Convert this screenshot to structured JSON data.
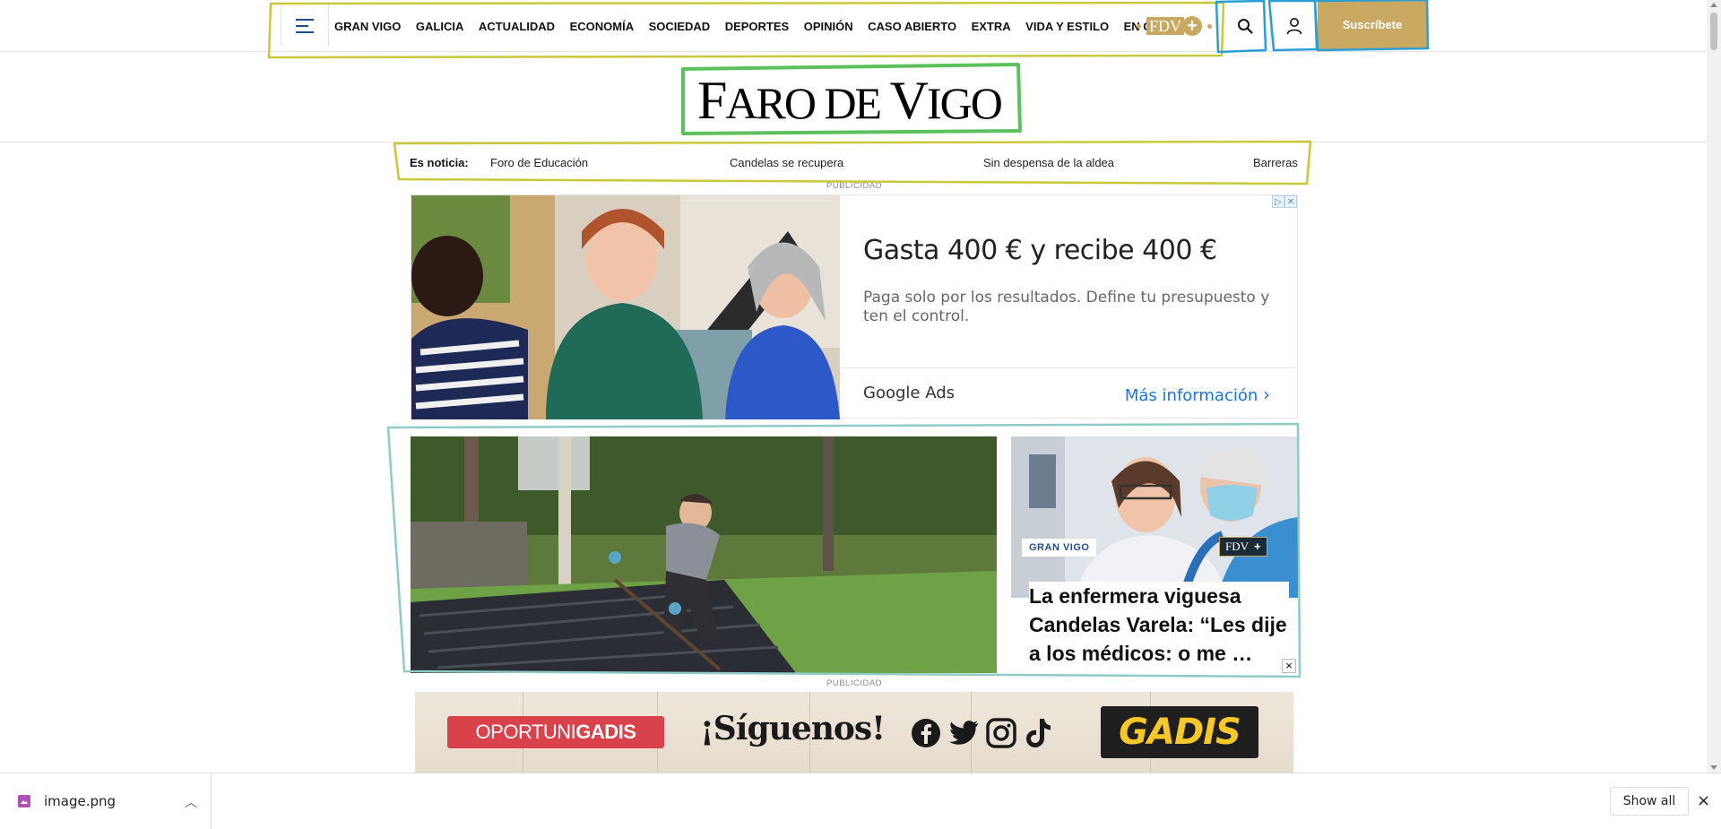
{
  "nav": {
    "menu_icon": "hamburger-menu-icon",
    "items": [
      "GRAN VIGO",
      "GALICIA",
      "ACTUALIDAD",
      "ECONOMÍA",
      "SOCIEDAD",
      "DEPORTES",
      "OPINIÓN",
      "CASO ABIERTO",
      "EXTRA",
      "VIDA Y ESTILO",
      "EN GALEGO"
    ],
    "premium_badge": "FDV",
    "premium_plus": "+",
    "search_icon": "search-icon",
    "user_icon": "user-icon",
    "subscribe_label": "Suscríbete"
  },
  "logo": {
    "part1_big": "F",
    "part1_small": "ARO DE ",
    "part2_big": "V",
    "part2_small": "IGO"
  },
  "ticker": {
    "label": "Es noticia:",
    "items": [
      "Foro de Educación",
      "Candelas se recupera",
      "Sin despensa de la aldea",
      "Barreras"
    ]
  },
  "ads": {
    "publicidad_label": "PUBLICIDAD",
    "google": {
      "headline": "Gasta 400 € y recibe 400 €",
      "description": "Paga solo por los resultados. Define tu presupuesto y ten el control.",
      "brand": "Google Ads",
      "cta": "Más información"
    },
    "gadis": {
      "oportuni_light": "OPORTUNI",
      "oportuni_bold": "GADIS",
      "follow": "¡Síguenos!",
      "logo": "GADIS",
      "socials": [
        "facebook-icon",
        "twitter-icon",
        "instagram-icon",
        "tiktok-icon"
      ]
    }
  },
  "stories": {
    "side": {
      "section": "GRAN VIGO",
      "premium_badge": "FDV",
      "premium_plus": "+",
      "headline": "La enfermera viguesa Candelas Varela: “Les dije a los médicos: o me …"
    },
    "close_label": "×"
  },
  "downloads": {
    "file_name": "image.png",
    "show_all": "Show all",
    "close": "×"
  },
  "colors": {
    "brand_gold": "#c9a961",
    "nav_blue": "#1f4e8c",
    "ad_link_blue": "#1a73e8",
    "annotation_yellow": "#c8c93a",
    "annotation_green": "#5cc05c",
    "annotation_blue": "#2a9fd6",
    "annotation_teal": "#8ecbc6"
  }
}
